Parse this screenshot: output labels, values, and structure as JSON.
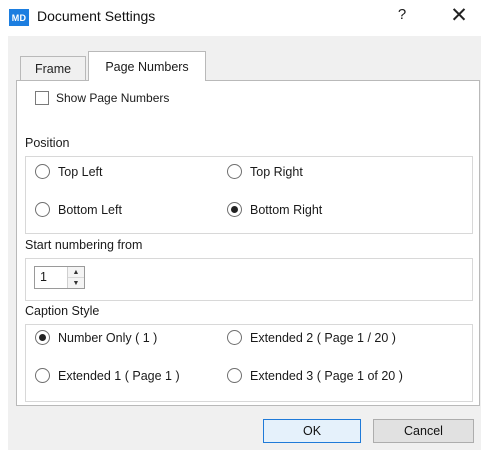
{
  "window": {
    "app_badge": "MD",
    "title": "Document Settings",
    "help": "?",
    "close": "✕"
  },
  "tabs": [
    {
      "label": "Frame",
      "active": false
    },
    {
      "label": "Page Numbers",
      "active": true
    }
  ],
  "show_page_numbers": {
    "label": "Show Page Numbers",
    "checked": false
  },
  "position": {
    "label": "Position",
    "options": [
      {
        "label": "Top Left",
        "selected": false
      },
      {
        "label": "Top Right",
        "selected": false
      },
      {
        "label": "Bottom Left",
        "selected": false
      },
      {
        "label": "Bottom Right",
        "selected": true
      }
    ]
  },
  "start_numbering": {
    "label": "Start numbering from",
    "value": "1"
  },
  "caption_style": {
    "label": "Caption Style",
    "options": [
      {
        "label": "Number Only ( 1 )",
        "selected": true
      },
      {
        "label": "Extended 2 ( Page 1 / 20 )",
        "selected": false
      },
      {
        "label": "Extended 1 ( Page 1 )",
        "selected": false
      },
      {
        "label": "Extended 3 ( Page 1 of 20 )",
        "selected": false
      }
    ]
  },
  "buttons": {
    "ok": "OK",
    "cancel": "Cancel"
  },
  "colors": {
    "accent": "#1c7ee0",
    "focus_border": "#1f7ad8"
  }
}
